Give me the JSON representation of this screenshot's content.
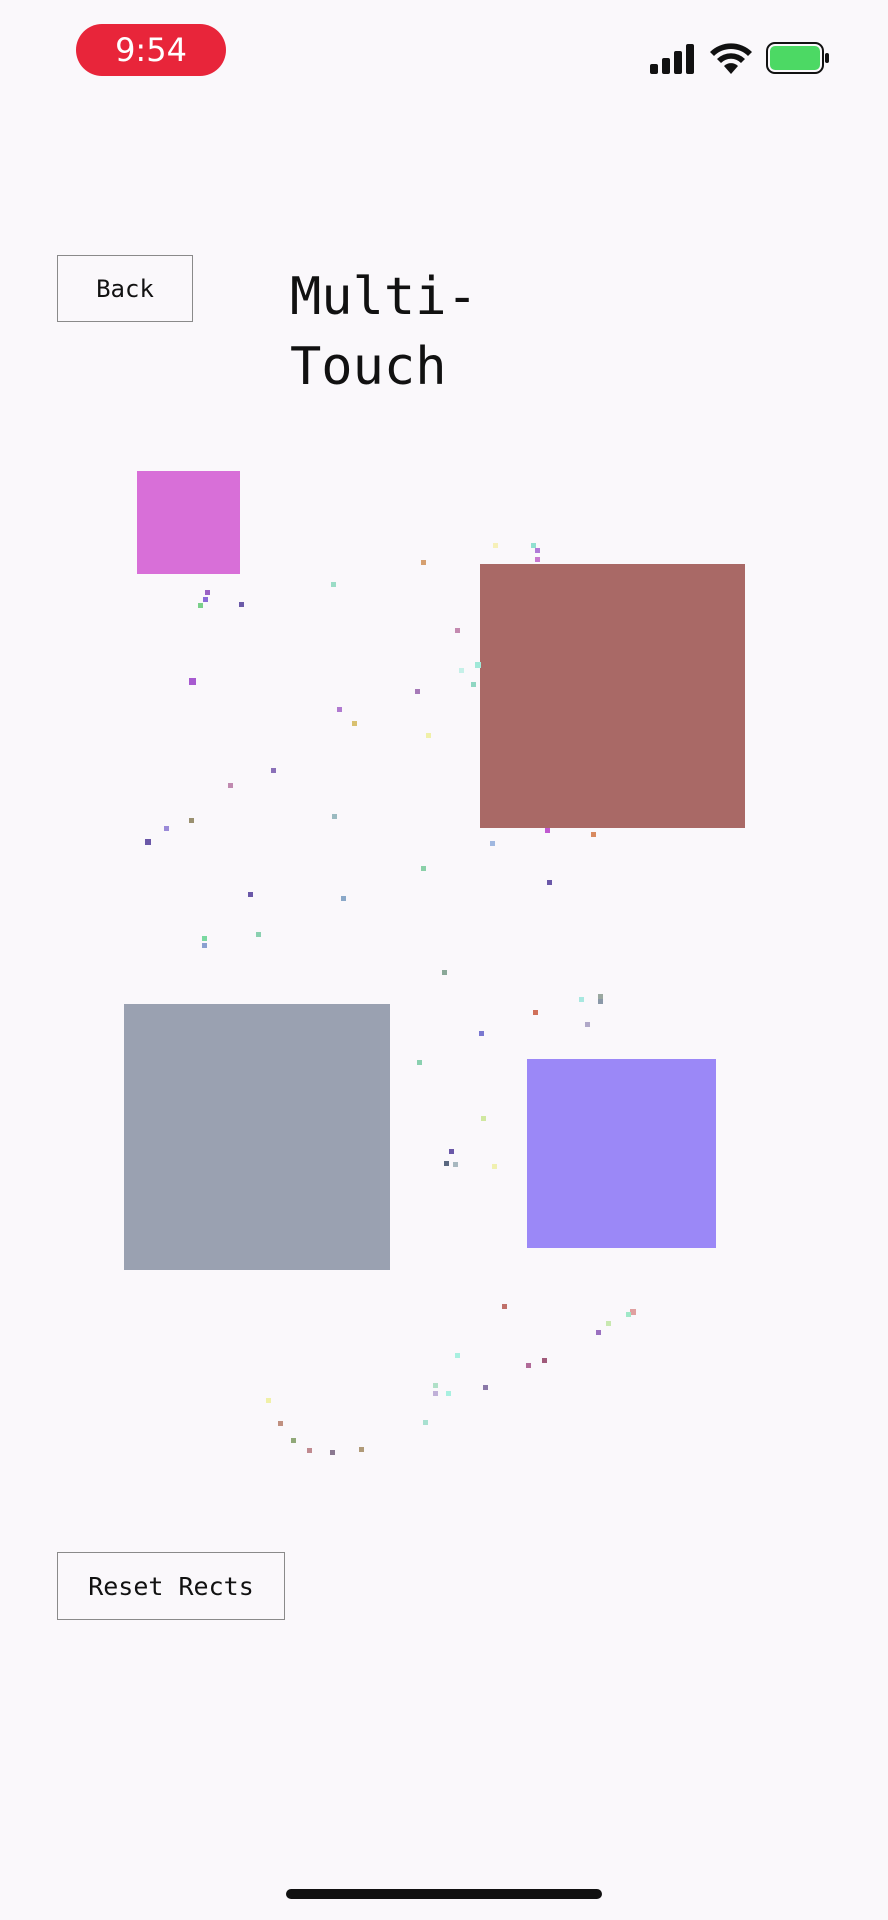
{
  "status_bar": {
    "time": "9:54",
    "time_pill_color": "#e8253a",
    "battery_color": "#4cd964",
    "icons": [
      "signal-icon",
      "wifi-icon",
      "battery-icon"
    ]
  },
  "header": {
    "back_label": "Back",
    "title": "Multi-Touch"
  },
  "rects": [
    {
      "name": "magenta",
      "color": "#d86fd8"
    },
    {
      "name": "brown",
      "color": "#a96966"
    },
    {
      "name": "gray",
      "color": "#9aa1b1"
    },
    {
      "name": "violet",
      "color": "#9b88f7"
    }
  ],
  "actions": {
    "reset_label": "Reset Rects"
  }
}
